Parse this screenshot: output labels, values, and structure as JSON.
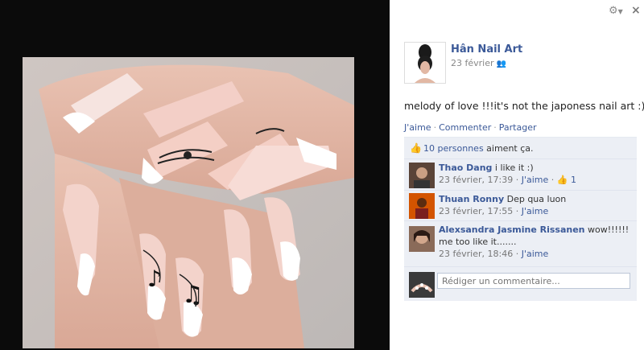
{
  "photo": {
    "description_icon": "photo-nail-art"
  },
  "header": {
    "settings_icon": "gear-icon",
    "close_label": "×"
  },
  "post": {
    "author": "Hân Nail Art",
    "date": "23 février",
    "message": "melody of love !!!it's not the japoness nail art :)",
    "actions": [
      "J'aime",
      "Commenter",
      "Partager"
    ]
  },
  "likes": {
    "count_text": "10 personnes",
    "suffix": " aiment ça."
  },
  "comments": [
    {
      "author": "Thao Dang",
      "text": " i like it :)",
      "time": "23 février, 17:39",
      "like_label": "J'aime",
      "like_count": "1"
    },
    {
      "author": "Thuan Ronny",
      "text": " Dep qua luon",
      "time": "23 février, 17:55",
      "like_label": "J'aime"
    },
    {
      "author": "Alexsandra Jasmine Rissanen",
      "text": " wow!!!!!! me too like it.......",
      "time": "23 février, 18:46",
      "like_label": "J'aime"
    }
  ],
  "composer": {
    "placeholder": "Rédiger un commentaire..."
  },
  "colors": {
    "link": "#3b5998",
    "ufi_bg": "#eceff5",
    "stage": "#0b0b0b"
  }
}
